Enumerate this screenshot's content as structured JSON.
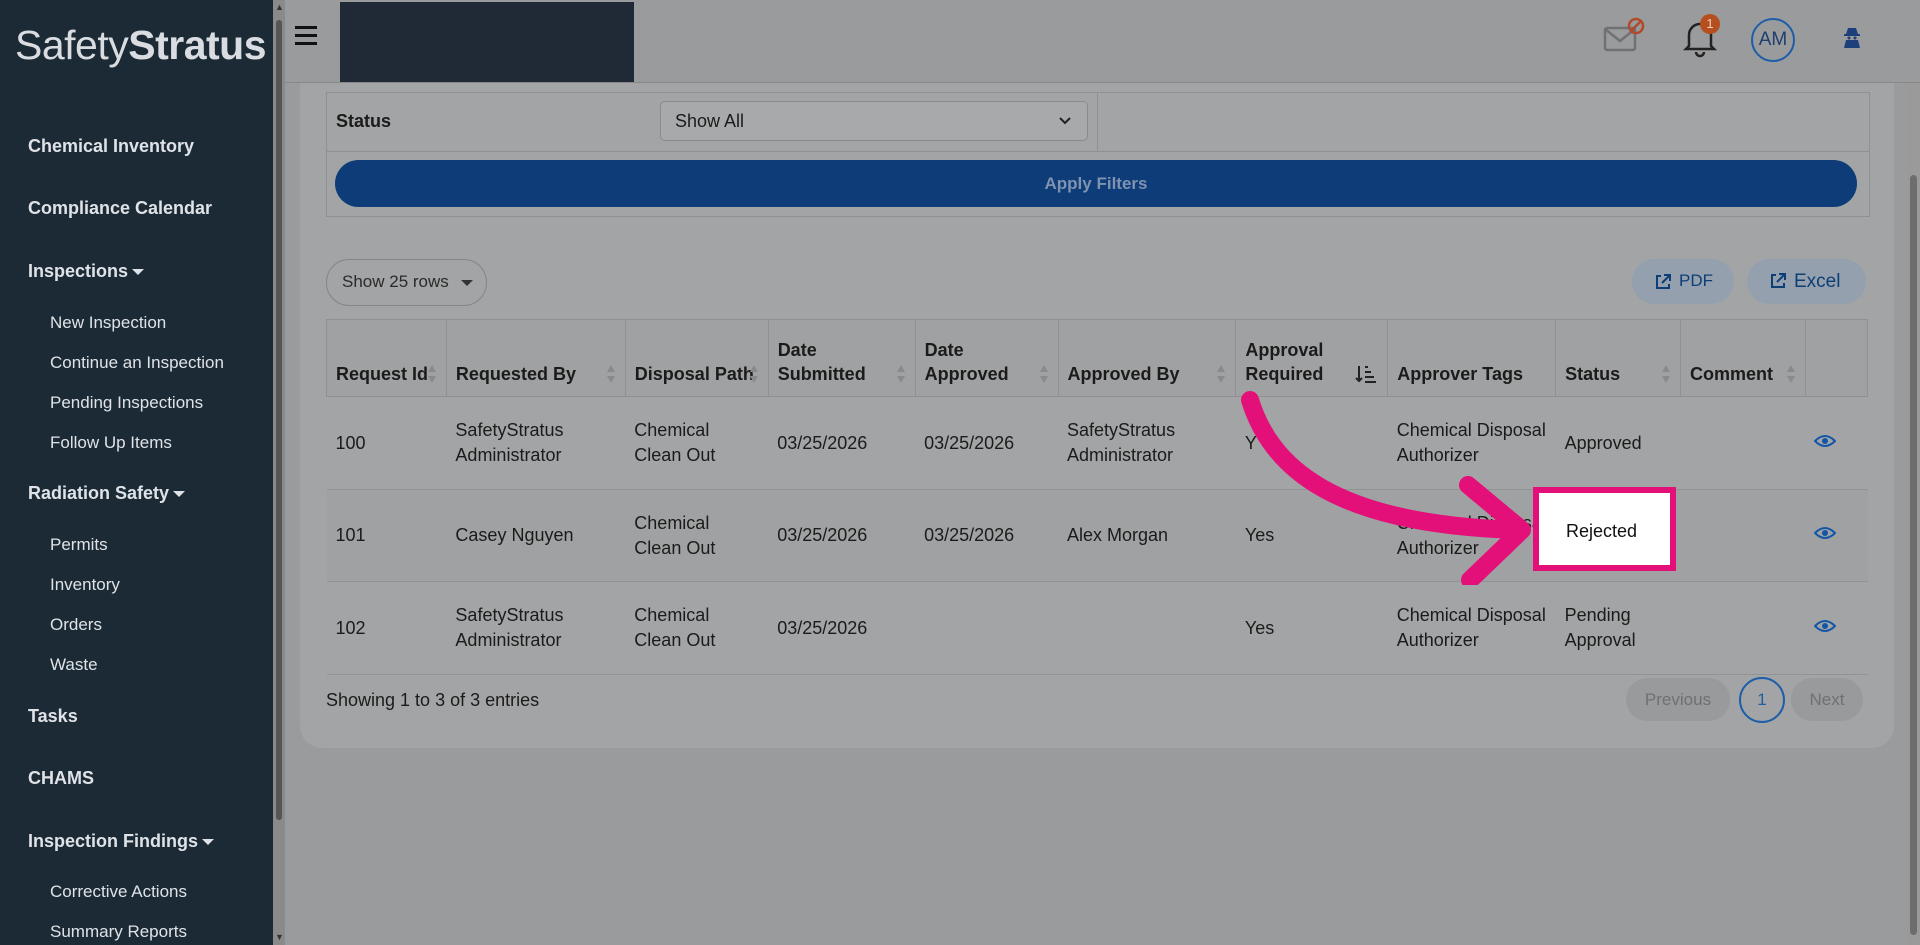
{
  "app": {
    "logo_light": "Safety",
    "logo_bold": "Stratus"
  },
  "sidebar": {
    "items": [
      {
        "label": "Chemical Inventory"
      },
      {
        "label": "Compliance Calendar"
      },
      {
        "label": "Inspections"
      },
      {
        "label": "New Inspection"
      },
      {
        "label": "Continue an Inspection"
      },
      {
        "label": "Pending Inspections"
      },
      {
        "label": "Follow Up Items"
      },
      {
        "label": "Radiation Safety"
      },
      {
        "label": "Permits"
      },
      {
        "label": "Inventory"
      },
      {
        "label": "Orders"
      },
      {
        "label": "Waste"
      },
      {
        "label": "Tasks"
      },
      {
        "label": "CHAMS"
      },
      {
        "label": "Inspection Findings"
      },
      {
        "label": "Corrective Actions"
      },
      {
        "label": "Summary Reports"
      }
    ]
  },
  "header": {
    "notification_count": "1",
    "avatar_initials": "AM"
  },
  "filters": {
    "status_label": "Status",
    "status_value": "Show All",
    "apply_label": "Apply Filters"
  },
  "toolbar": {
    "rows_label": "Show 25 rows",
    "pdf_label": "PDF",
    "excel_label": "Excel"
  },
  "table": {
    "columns": [
      "Request Id",
      "Requested By",
      "Disposal Path",
      "Date Submitted",
      "Date Approved",
      "Approved By",
      "Approval Required",
      "Approver Tags",
      "Status",
      "Comment"
    ],
    "rows": [
      {
        "id": "100",
        "requested_by": "SafetyStratus Administrator",
        "path": "Chemical Clean Out",
        "submitted": "03/25/2026",
        "approved": "03/25/2026",
        "approved_by": "SafetyStratus Administrator",
        "required": "Y",
        "tags": "Chemical Disposal Authorizer",
        "status": "Approved",
        "comment": ""
      },
      {
        "id": "101",
        "requested_by": "Casey Nguyen",
        "path": "Chemical Clean Out",
        "submitted": "03/25/2026",
        "approved": "03/25/2026",
        "approved_by": "Alex Morgan",
        "required": "Yes",
        "tags": "Chemical Disposal Authorizer",
        "status": "Rejected",
        "comment": ""
      },
      {
        "id": "102",
        "requested_by": "SafetyStratus Administrator",
        "path": "Chemical Clean Out",
        "submitted": "03/25/2026",
        "approved": "",
        "approved_by": "",
        "required": "Yes",
        "tags": "Chemical Disposal Authorizer",
        "status": "Pending Approval",
        "comment": ""
      }
    ]
  },
  "footer": {
    "showing": "Showing 1 to 3 of 3 entries",
    "previous": "Previous",
    "page": "1",
    "next": "Next"
  },
  "colors": {
    "highlight": "#e4107a",
    "primary": "#0e3c78",
    "sidebar": "#1c2a35"
  }
}
